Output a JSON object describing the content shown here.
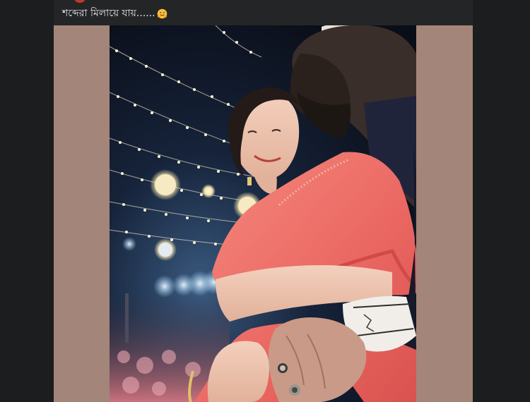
{
  "post": {
    "caption": "শব্দেরা মিলায়ে যায়......",
    "caption_emoji": "hugging-face-emoji",
    "photo_description_icon": "couple-photo"
  },
  "colors": {
    "page_background": "#1c1d1f",
    "card_background": "#242526",
    "caption_text": "#e4e6eb",
    "media_letterbox": "#a3857a",
    "dress_pink": "#ef6f6a"
  }
}
